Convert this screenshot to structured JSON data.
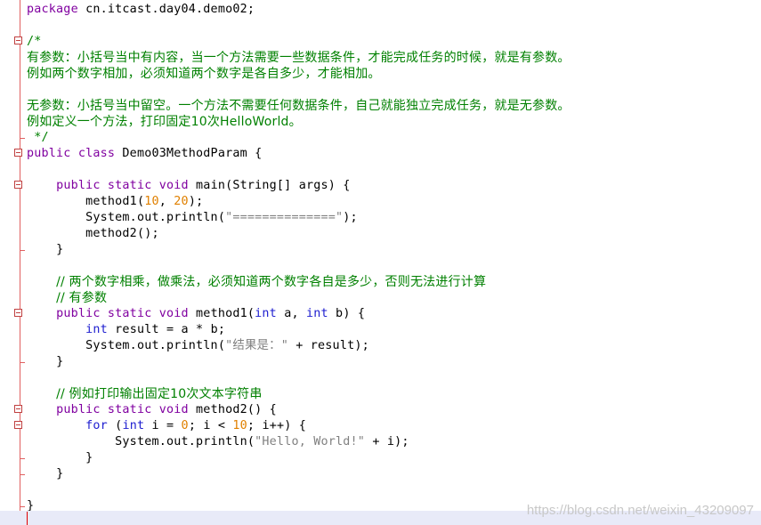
{
  "code": {
    "package_kw": "package",
    "package_name": " cn.itcast.day04.demo02;",
    "comment_open": "/*",
    "comment_line1": "有参数：小括号当中有内容，当一个方法需要一些数据条件，才能完成任务的时候，就是有参数。",
    "comment_line2": "例如两个数字相加，必须知道两个数字是各自多少，才能相加。",
    "comment_line3": "无参数：小括号当中留空。一个方法不需要任何数据条件，自己就能独立完成任务，就是无参数。",
    "comment_line4": "例如定义一个方法，打印固定10次HelloWorld。",
    "comment_close": " */",
    "class_decl_kw": "public class",
    "class_name": " Demo03MethodParam {",
    "main_kw": "public static void",
    "main_rest": " main(String[] args) {",
    "call1_pre": "method1(",
    "call1_a": "10",
    "call1_sep": ", ",
    "call1_b": "20",
    "call1_post": ");",
    "print_pre": "System.out.println(",
    "print_str": "\"==============\"",
    "print_post": ");",
    "call2": "method2();",
    "close_brace": "}",
    "comment_mul1": "// 两个数字相乘，做乘法，必须知道两个数字各自是多少，否则无法进行计算",
    "comment_mul2": "// 有参数",
    "m1_kw": "public static void",
    "m1_name": " method1(",
    "m1_int1": "int",
    "m1_a": " a, ",
    "m1_int2": "int",
    "m1_b": " b) {",
    "res_int": "int",
    "res_rest": " result = a * b;",
    "print2_pre": "System.out.println(",
    "print2_str": "\"结果是：\"",
    "print2_post": " + result);",
    "comment_loop": "// 例如打印输出固定10次文本字符串",
    "m2_kw": "public static void",
    "m2_name": " method2() {",
    "for_kw": "for",
    "for_p1": " (",
    "for_int": "int",
    "for_p2": " i = ",
    "for_zero": "0",
    "for_p3": "; i < ",
    "for_ten": "10",
    "for_p4": "; i++) {",
    "print3_pre": "System.out.println(",
    "print3_str": "\"Hello, World!\"",
    "print3_post": " + i);"
  },
  "watermark": "https://blog.csdn.net/weixin_43209097",
  "colors": {
    "keyword": "#8000a0",
    "type": "#2020d0",
    "number": "#e08000",
    "string": "#808080",
    "comment": "#008000"
  }
}
